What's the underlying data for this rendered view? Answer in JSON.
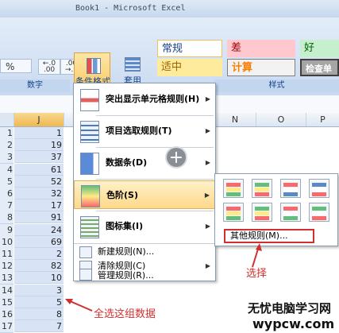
{
  "window": {
    "title": "Book1 - Microsoft Excel"
  },
  "ribbon": {
    "percent_symbol": "%",
    "decimal_increase": "←.0\n.00",
    "decimal_decrease": ".00\n→.0",
    "number_group_label": "数字",
    "conditional_formatting_label": "条件格式",
    "format_as_table_label": "套用\n表格格式",
    "styles_group_label": "样式",
    "styles": [
      {
        "label": "常规",
        "bg": "#ffffff",
        "fg": "#000000"
      },
      {
        "label": "差",
        "bg": "#ffc7ce",
        "fg": "#9c0006"
      },
      {
        "label": "好",
        "bg": "#c6efce",
        "fg": "#006100"
      },
      {
        "label": "适中",
        "bg": "#ffeb9c",
        "fg": "#9c6500"
      },
      {
        "label": "计算",
        "bg": "#f2f2f2",
        "fg": "#fa7d00"
      },
      {
        "label": "检查单元",
        "bg": "#a5a5a5",
        "fg": "#ffffff"
      }
    ]
  },
  "grid": {
    "column_headers": [
      "J",
      "N",
      "O",
      "P"
    ],
    "rows": [
      {
        "row": "1",
        "value": "1"
      },
      {
        "row": "2",
        "value": "19"
      },
      {
        "row": "3",
        "value": "37"
      },
      {
        "row": "4",
        "value": "61"
      },
      {
        "row": "5",
        "value": "52"
      },
      {
        "row": "6",
        "value": "32"
      },
      {
        "row": "7",
        "value": "17"
      },
      {
        "row": "8",
        "value": "91"
      },
      {
        "row": "9",
        "value": "24"
      },
      {
        "row": "10",
        "value": "69"
      },
      {
        "row": "11",
        "value": "2"
      },
      {
        "row": "12",
        "value": "82"
      },
      {
        "row": "13",
        "value": "10"
      },
      {
        "row": "14",
        "value": "3"
      },
      {
        "row": "15",
        "value": "5"
      },
      {
        "row": "16",
        "value": "8"
      },
      {
        "row": "17",
        "value": "7"
      }
    ]
  },
  "menu": {
    "items": [
      {
        "label": "突出显示单元格规则(H)",
        "icon": "highlight-rules-icon"
      },
      {
        "label": "项目选取规则(T)",
        "icon": "top-bottom-rules-icon"
      },
      {
        "label": "数据条(D)",
        "icon": "data-bars-icon"
      },
      {
        "label": "色阶(S)",
        "icon": "color-scales-icon"
      },
      {
        "label": "图标集(I)",
        "icon": "icon-sets-icon"
      }
    ],
    "small_items": [
      {
        "label": "新建规则(N)...",
        "icon": "new-rule-icon"
      },
      {
        "label": "清除规则(C)",
        "icon": "clear-rules-icon"
      },
      {
        "label": "管理规则(R)...",
        "icon": "manage-rules-icon"
      }
    ],
    "arrow": "▶"
  },
  "submenu": {
    "more_rules": "其他规则(M)...",
    "swatch_colors": [
      [
        "#f8696b",
        "#ffeb84",
        "#63be7b"
      ],
      [
        "#63be7b",
        "#ffeb84",
        "#f8696b"
      ],
      [
        "#f8696b",
        "#fcfcff",
        "#5a8ac6"
      ],
      [
        "#5a8ac6",
        "#fcfcff",
        "#f8696b"
      ],
      [
        "#f8696b",
        "#ffeb84",
        "#63be7b"
      ],
      [
        "#63be7b",
        "#ffeb84",
        "#f8696b"
      ],
      [
        "#f8696b",
        "#fcfcff",
        "#63be7b"
      ],
      [
        "#63be7b",
        "#fcfcff",
        "#f8696b"
      ]
    ]
  },
  "annotations": {
    "select_label": "选择",
    "select_all_label": "全选这组数据",
    "plus": "+"
  },
  "watermark": {
    "line1": "无忧电脑学习网",
    "line2": "wypcw.com"
  }
}
